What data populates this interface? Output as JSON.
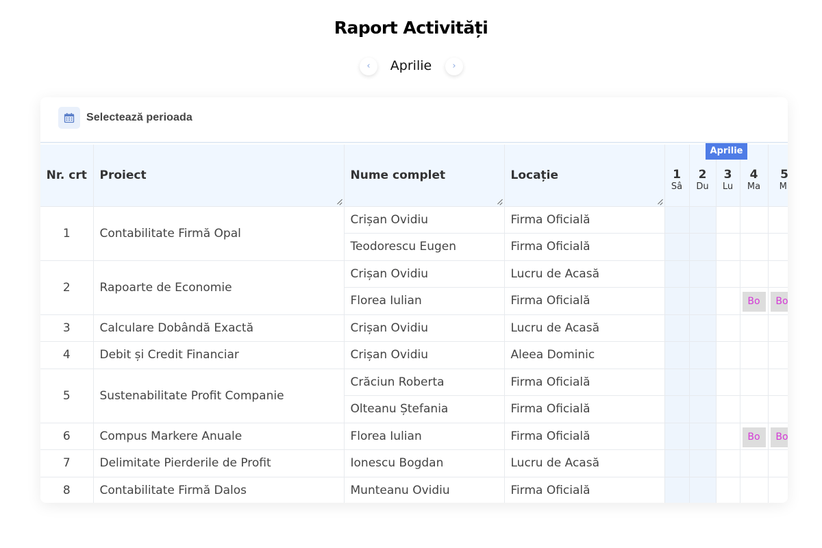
{
  "header": {
    "title": "Raport Activități",
    "month": "Aprilie",
    "prev_icon": "chevron-left-icon",
    "next_icon": "chevron-right-icon"
  },
  "toolbar": {
    "period_label": "Selectează perioada",
    "period_icon": "calendar-icon"
  },
  "colors": {
    "accent": "#4f7ce6",
    "header_bg": "#f0f7ff",
    "weekend_bg": "#eef5fd",
    "badge_bg": "#dddddd",
    "badge_text": "#d43bd6"
  },
  "table": {
    "columns": {
      "nr": "Nr. crt",
      "project": "Proiect",
      "name": "Nume complet",
      "location": "Locație"
    },
    "month_tag": "Aprilie",
    "days": [
      {
        "num": "1",
        "name": "Sâ"
      },
      {
        "num": "2",
        "name": "Du"
      },
      {
        "num": "3",
        "name": "Lu"
      },
      {
        "num": "4",
        "name": "Ma"
      },
      {
        "num": "5",
        "name": "Mi"
      }
    ],
    "badge_text": "Bo",
    "rows": [
      {
        "nr": "1",
        "project": "Contabilitate Firmă Opal",
        "entries": [
          {
            "name": "Crișan Ovidiu",
            "location": "Firma Oficială"
          },
          {
            "name": "Teodorescu Eugen",
            "location": "Firma Oficială"
          }
        ]
      },
      {
        "nr": "2",
        "project": "Rapoarte de Economie",
        "entries": [
          {
            "name": "Crișan Ovidiu",
            "location": "Lucru de Acasă"
          },
          {
            "name": "Florea Iulian",
            "location": "Firma Oficială"
          }
        ]
      },
      {
        "nr": "3",
        "project": "Calculare Dobândă Exactă",
        "entries": [
          {
            "name": "Crișan Ovidiu",
            "location": "Lucru de Acasă"
          }
        ]
      },
      {
        "nr": "4",
        "project": "Debit și Credit Financiar",
        "entries": [
          {
            "name": "Crișan Ovidiu",
            "location": "Aleea Dominic"
          }
        ]
      },
      {
        "nr": "5",
        "project": "Sustenabilitate Profit Companie",
        "entries": [
          {
            "name": "Crăciun Roberta",
            "location": "Firma Oficială"
          },
          {
            "name": "Olteanu Ștefania",
            "location": "Firma Oficială"
          }
        ]
      },
      {
        "nr": "6",
        "project": "Compus Markere Anuale",
        "entries": [
          {
            "name": "Florea Iulian",
            "location": "Firma Oficială"
          }
        ]
      },
      {
        "nr": "7",
        "project": "Delimitate Pierderile de Profit",
        "entries": [
          {
            "name": "Ionescu Bogdan",
            "location": "Lucru de Acasă"
          }
        ]
      },
      {
        "nr": "8",
        "project": "Contabilitate Firmă Dalos",
        "entries": [
          {
            "name": "Munteanu Ovidiu",
            "location": "Firma Oficială"
          }
        ]
      }
    ]
  }
}
